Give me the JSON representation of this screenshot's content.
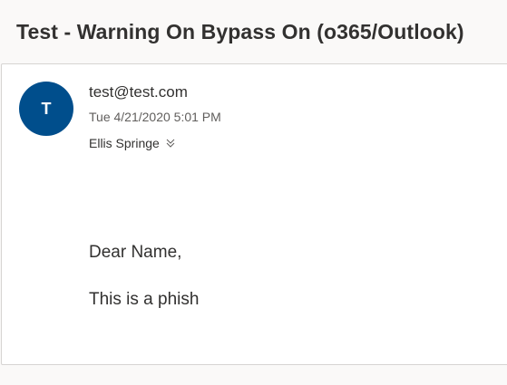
{
  "email": {
    "subject": "Test - Warning On Bypass On (o365/Outlook)",
    "avatar_initial": "T",
    "sender": "test@test.com",
    "date": "Tue 4/21/2020 5:01 PM",
    "recipient": "Ellis Springe",
    "body": {
      "greeting": "Dear Name,",
      "message": "This is a phish"
    }
  },
  "colors": {
    "avatar_background": "#004e8c",
    "page_background": "#faf9f8",
    "card_background": "#ffffff"
  },
  "icons": {
    "recipient_expand": "chevron-double-down-icon"
  }
}
